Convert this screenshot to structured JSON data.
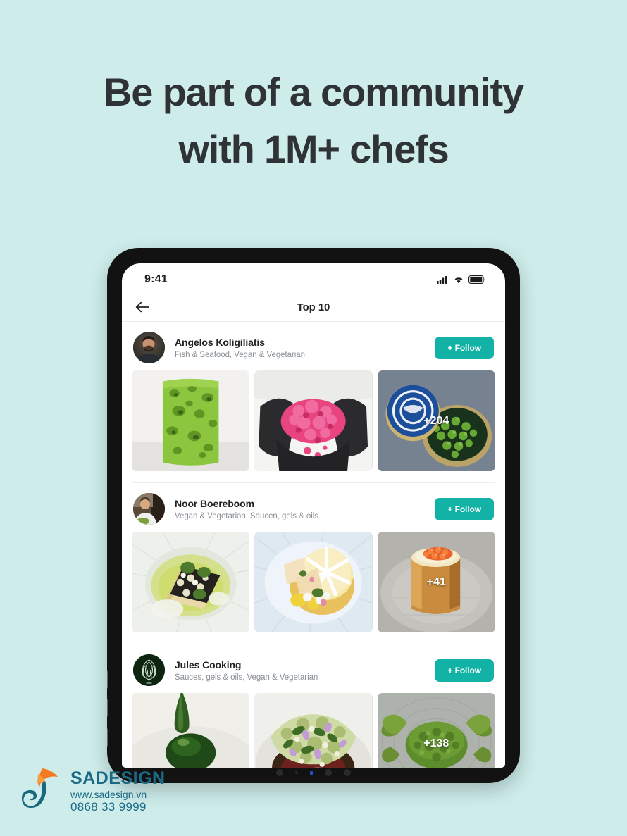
{
  "colors": {
    "background": "#cdecea",
    "accent": "#12b2a6",
    "headline_text": "#2f3337",
    "watermark": "#1b6b86",
    "bezel": "#121212"
  },
  "headline": {
    "line1": "Be part of a community",
    "line2": "with 1M+ chefs"
  },
  "device": {
    "status_bar": {
      "time": "9:41",
      "icons": [
        "signal-icon",
        "wifi-icon",
        "battery-icon"
      ]
    },
    "navbar": {
      "back_icon": "arrow-left-icon",
      "title": "Top 10"
    },
    "chefs": [
      {
        "name": "Angelos Koligiliatis",
        "tags": "Fish & Seafood, Vegan & Vegetarian",
        "follow_label": "+ Follow",
        "avatar_name": "chef-avatar-angelos",
        "photos": [
          {
            "name": "green-sponge-cake-photo",
            "badge": ""
          },
          {
            "name": "pink-crumble-gloves-photo",
            "badge": ""
          },
          {
            "name": "green-caviar-tin-photo",
            "badge": "+204"
          }
        ]
      },
      {
        "name": "Noor Boereboom",
        "tags": "Vegan & Vegetarian, Saucen, gels & oils",
        "follow_label": "+ Follow",
        "avatar_name": "chef-avatar-noor",
        "photos": [
          {
            "name": "green-oil-tart-photo",
            "badge": ""
          },
          {
            "name": "lemon-tart-plated-photo",
            "badge": ""
          },
          {
            "name": "caviar-cylinder-photo",
            "badge": "+41"
          }
        ]
      },
      {
        "name": "Jules Cooking",
        "tags": "Sauces, gels & oils, Vegan & Vegetarian",
        "follow_label": "+ Follow",
        "avatar_name": "chef-avatar-jules",
        "photos": [
          {
            "name": "green-oil-droplets-photo",
            "badge": ""
          },
          {
            "name": "herb-crust-flowers-photo",
            "badge": ""
          },
          {
            "name": "green-crab-photo",
            "badge": "+138"
          }
        ]
      }
    ]
  },
  "watermark": {
    "brand": "SADESIGN",
    "url": "www.sadesign.vn",
    "phone": "0868 33 9999",
    "logo_name": "sadesign-logo"
  }
}
